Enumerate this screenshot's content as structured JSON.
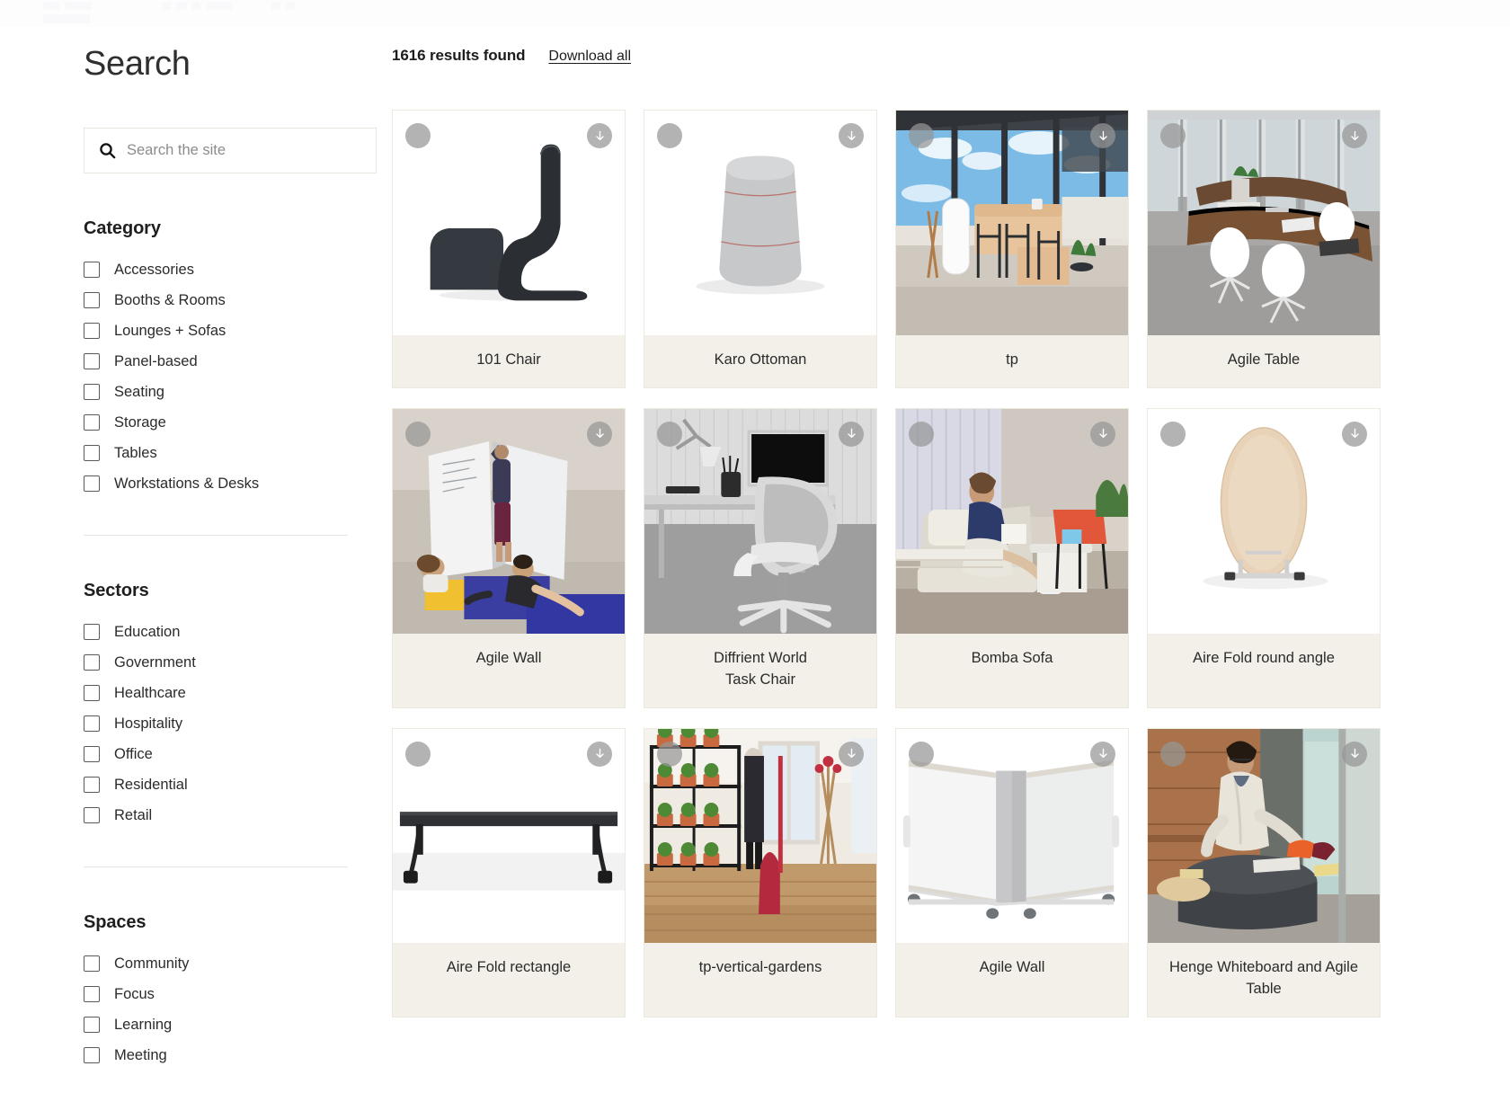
{
  "page": {
    "title": "Search"
  },
  "search": {
    "placeholder": "Search the site",
    "value": "",
    "icon": "search-icon"
  },
  "facets": [
    {
      "id": "category",
      "title": "Category",
      "options": [
        "Accessories",
        "Booths & Rooms",
        "Lounges + Sofas",
        "Panel-based",
        "Seating",
        "Storage",
        "Tables",
        "Workstations & Desks"
      ]
    },
    {
      "id": "sectors",
      "title": "Sectors",
      "options": [
        "Education",
        "Government",
        "Healthcare",
        "Hospitality",
        "Office",
        "Residential",
        "Retail"
      ]
    },
    {
      "id": "spaces",
      "title": "Spaces",
      "options": [
        "Community",
        "Focus",
        "Learning",
        "Meeting"
      ]
    }
  ],
  "results": {
    "count_label": "1616 results found",
    "download_all_label": "Download all",
    "badge_icon": "download-arrow-icon",
    "select_icon": "select-circle-icon",
    "items": [
      {
        "title": "101 Chair",
        "art": "chair-101"
      },
      {
        "title": "Karo Ottoman",
        "art": "ottoman-karo"
      },
      {
        "title": "tp",
        "art": "photo-lounge-windows"
      },
      {
        "title": "Agile Table",
        "art": "photo-conference-table"
      },
      {
        "title": "Agile Wall",
        "art": "photo-agile-wall-room"
      },
      {
        "title": "Diffrient World\nTask Chair",
        "art": "photo-task-chair-bw"
      },
      {
        "title": "Bomba Sofa",
        "art": "photo-bomba-sofa"
      },
      {
        "title": "Aire Fold round angle",
        "art": "table-round-fold"
      },
      {
        "title": "Aire Fold rectangle",
        "art": "table-rect-fold"
      },
      {
        "title": "tp-vertical-gardens",
        "art": "photo-vertical-garden"
      },
      {
        "title": "Agile Wall",
        "art": "whiteboard-pair"
      },
      {
        "title": "Henge Whiteboard and Agile Table",
        "art": "photo-henge-table"
      }
    ]
  },
  "colors": {
    "card_caption_bg": "#f2f0e8",
    "card_border": "#eceade",
    "divider": "#e6e4dd",
    "text": "#2b2b2b",
    "badge": "#969696"
  }
}
